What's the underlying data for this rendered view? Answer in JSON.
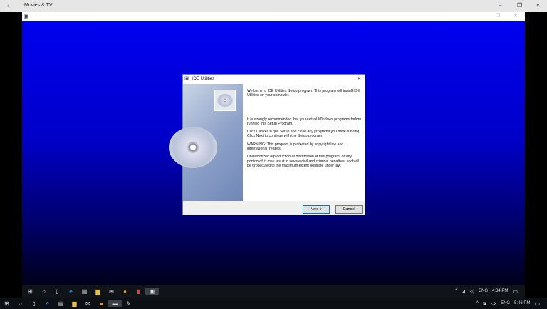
{
  "app": {
    "title": "Movies & TV",
    "back_icon": "←"
  },
  "dialog": {
    "title": "IDE Utilities",
    "paragraphs": [
      "Welcome to IDE Utilities Setup program. This program will install IDE Utilities on your computer.",
      "It is strongly recommended that you exit all Windows programs before running this Setup Program.",
      "Click Cancel to quit Setup and close any programs you have running.  Click Next to continue with the Setup program.",
      "WARNING: This program is protected by copyright law and international treaties.",
      "Unauthorized reproduction or distribution of this program, or any portion of it, may result in severe civil and criminal penalties, and will be prosecuted to the maximum extent possible under law."
    ],
    "next_label": "Next >",
    "cancel_label": "Cancel"
  },
  "inner_taskbar": {
    "lang": "ENG",
    "time": "4:34 PM"
  },
  "outer_taskbar": {
    "lang": "ENG",
    "time": "5:46 PM"
  }
}
